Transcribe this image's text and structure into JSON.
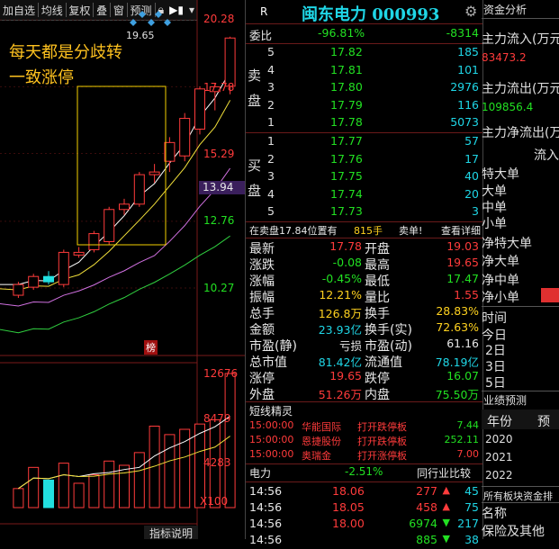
{
  "toolbar": {
    "items": [
      "加自选",
      "均线",
      "复权",
      "叠",
      "窗",
      "预测"
    ]
  },
  "left_chart": {
    "price_labels": [
      "20.28",
      "17.78",
      "15.29",
      "12.76",
      "10.27"
    ],
    "current_price_tag": "13.94",
    "peak_label": "19.65",
    "annotation_line1": "每天都是分歧转",
    "annotation_line2": "一致涨停",
    "bang_label": "榜",
    "volume_labels": [
      "12676",
      "8479",
      "4283"
    ],
    "volume_unit": "X100",
    "bottom_tab": "指标说明",
    "candles": [
      {
        "o": 10.0,
        "c": 10.4,
        "h": 10.5,
        "l": 9.9
      },
      {
        "o": 10.3,
        "c": 10.7,
        "h": 10.8,
        "l": 10.2
      },
      {
        "o": 10.7,
        "c": 10.5,
        "h": 10.9,
        "l": 10.4
      },
      {
        "o": 10.4,
        "c": 11.6,
        "h": 11.7,
        "l": 10.3
      },
      {
        "o": 11.5,
        "c": 11.6,
        "h": 11.8,
        "l": 11.4
      },
      {
        "o": 11.7,
        "c": 12.3,
        "h": 12.4,
        "l": 11.6
      },
      {
        "o": 12.0,
        "c": 13.2,
        "h": 13.3,
        "l": 11.9
      },
      {
        "o": 13.2,
        "c": 13.4,
        "h": 13.6,
        "l": 13.0
      },
      {
        "o": 13.4,
        "c": 14.5,
        "h": 14.6,
        "l": 13.3
      },
      {
        "o": 14.5,
        "c": 14.6,
        "h": 14.9,
        "l": 14.2
      },
      {
        "o": 15.0,
        "c": 15.7,
        "h": 15.9,
        "l": 14.6
      },
      {
        "o": 15.2,
        "c": 16.6,
        "h": 16.8,
        "l": 15.0
      },
      {
        "o": 16.2,
        "c": 17.7,
        "h": 17.8,
        "l": 16.0
      },
      {
        "o": 17.6,
        "c": 17.78,
        "h": 17.9,
        "l": 16.9
      },
      {
        "o": 17.8,
        "c": 19.6,
        "h": 19.65,
        "l": 17.5
      }
    ],
    "volumes": [
      1800,
      3800,
      2600,
      4200,
      2300,
      3100,
      4400,
      4000,
      5200,
      7700,
      6900,
      7400,
      7900,
      8300,
      12676
    ]
  },
  "quote": {
    "header_r": "R",
    "title": "闽东电力 000993",
    "weibi_label": "委比",
    "weibi_pct": "-96.81%",
    "weibi_val": "-8314",
    "sell_label": "卖盘",
    "buy_label": "买盘",
    "sells": [
      {
        "n": "5",
        "p": "17.82",
        "v": "185"
      },
      {
        "n": "4",
        "p": "17.81",
        "v": "101"
      },
      {
        "n": "3",
        "p": "17.80",
        "v": "2976"
      },
      {
        "n": "2",
        "p": "17.79",
        "v": "116"
      },
      {
        "n": "1",
        "p": "17.78",
        "v": "5073"
      }
    ],
    "buys": [
      {
        "n": "1",
        "p": "17.77",
        "v": "57"
      },
      {
        "n": "2",
        "p": "17.76",
        "v": "17"
      },
      {
        "n": "3",
        "p": "17.75",
        "v": "40"
      },
      {
        "n": "4",
        "p": "17.74",
        "v": "20"
      },
      {
        "n": "5",
        "p": "17.73",
        "v": "3"
      }
    ],
    "sell_note": "在卖盘17.84位置有",
    "sell_note_qty": "815手",
    "sell_note_tag": "卖单!",
    "detail_link": "查看详细",
    "stats": [
      {
        "l1": "最新",
        "v1": "17.78",
        "c1": "red",
        "l2": "开盘",
        "v2": "19.03",
        "c2": "red"
      },
      {
        "l1": "涨跌",
        "v1": "-0.08",
        "c1": "grn",
        "l2": "最高",
        "v2": "19.65",
        "c2": "red"
      },
      {
        "l1": "涨幅",
        "v1": "-0.45%",
        "c1": "grn",
        "l2": "最低",
        "v2": "17.47",
        "c2": "grn"
      },
      {
        "l1": "振幅",
        "v1": "12.21%",
        "c1": "yel",
        "l2": "量比",
        "v2": "1.55",
        "c2": "red"
      },
      {
        "l1": "总手",
        "v1": "126.8万",
        "c1": "yel",
        "l2": "换手",
        "v2": "28.83%",
        "c2": "yel"
      },
      {
        "l1": "金额",
        "v1": "23.93亿",
        "c1": "cyn",
        "l2": "换手(实)",
        "v2": "72.63%",
        "c2": "yel"
      },
      {
        "l1": "市盈(静)",
        "v1": "亏损",
        "c1": "wht",
        "l2": "市盈(动)",
        "v2": "61.16",
        "c2": "wht"
      },
      {
        "l1": "总市值",
        "v1": "81.42亿",
        "c1": "cyn",
        "l2": "流通值",
        "v2": "78.19亿",
        "c2": "cyn"
      },
      {
        "l1": "涨停",
        "v1": "19.65",
        "c1": "red",
        "l2": "跌停",
        "v2": "16.07",
        "c2": "grn"
      },
      {
        "l1": "外盘",
        "v1": "51.26万",
        "c1": "red",
        "l2": "内盘",
        "v2": "75.50万",
        "c2": "grn"
      }
    ],
    "news_header": "短线精灵",
    "news": [
      {
        "t": "15:00:00",
        "name": "华能国际",
        "act": "打开跌停板",
        "val": "7.44",
        "c": "grn"
      },
      {
        "t": "15:00:00",
        "name": "恩捷股份",
        "act": "打开跌停板",
        "val": "252.11",
        "c": "grn"
      },
      {
        "t": "15:00:00",
        "name": "奥瑞金",
        "act": "打开涨停板",
        "val": "7.00",
        "c": "red"
      }
    ],
    "sector_name": "电力",
    "sector_pct": "-2.51%",
    "sector_link": "同行业比较",
    "ticks": [
      {
        "t": "14:56",
        "p": "18.06",
        "v": "277",
        "dir": "up",
        "n": "45"
      },
      {
        "t": "14:56",
        "p": "18.05",
        "v": "458",
        "dir": "up",
        "n": "75"
      },
      {
        "t": "14:56",
        "p": "18.00",
        "v": "6974",
        "dir": "down",
        "n": "217"
      },
      {
        "t": "14:56",
        "p": "",
        "v": "885",
        "dir": "down",
        "n": "38"
      }
    ]
  },
  "fund": {
    "title": "资金分析",
    "inflow_label": "主力流入(万元",
    "inflow_val": "83473.2",
    "outflow_label": "主力流出(万元",
    "outflow_val": "109856.4",
    "net_label": "主力净流出(万",
    "flow_label": "流入",
    "orders": [
      "特大单",
      "大单",
      "中单",
      "小单"
    ],
    "net_orders": [
      "净特大单",
      "净大单",
      "净中单",
      "净小单"
    ],
    "time_label": "时间",
    "days": [
      "今日",
      "2日",
      "3日",
      "5日"
    ],
    "forecast_title": "业绩预测",
    "year_label": "年份",
    "forecast_col": "预",
    "years": [
      "2020",
      "2021",
      "2022"
    ],
    "sector_funds": "所有板块资金排",
    "sector_item": "保险及其他"
  }
}
